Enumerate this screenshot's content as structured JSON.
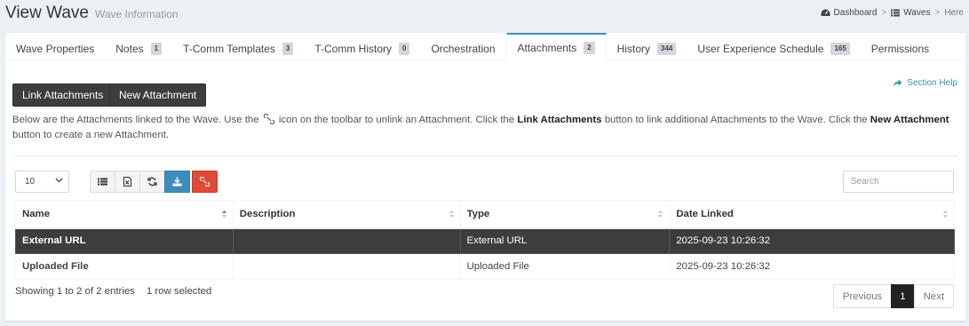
{
  "header": {
    "title": "View Wave",
    "subtitle": "Wave Information"
  },
  "breadcrumb": {
    "dashboard": "Dashboard",
    "waves": "Waves",
    "here": "Here",
    "separator": ">"
  },
  "tabs": [
    {
      "label": "Wave Properties",
      "badge": null
    },
    {
      "label": "Notes",
      "badge": "1"
    },
    {
      "label": "T-Comm Templates",
      "badge": "3"
    },
    {
      "label": "T-Comm History",
      "badge": "0"
    },
    {
      "label": "Orchestration",
      "badge": null
    },
    {
      "label": "Attachments",
      "badge": "2"
    },
    {
      "label": "History",
      "badge": "344"
    },
    {
      "label": "User Experience Schedule",
      "badge": "165"
    },
    {
      "label": "Permissions",
      "badge": null
    }
  ],
  "active_tab": "Attachments",
  "actions": {
    "link_label": "Link Attachments",
    "new_label": "New Attachment",
    "section_help": "Section Help"
  },
  "description": {
    "p1": "Below are the Attachments linked to the Wave. Use the",
    "p2": "icon on the toolbar to unlink an Attachment. Click the",
    "b1": "Link Attachments",
    "p3": "button to link additional Attachments to the Wave. Click the",
    "b2": "New Attachment",
    "p4": "button to create a new Attachment."
  },
  "table_controls": {
    "page_length": "10",
    "search_placeholder": "Search",
    "toolbar_icons": [
      "list-icon",
      "excel-icon",
      "refresh-icon",
      "download-icon",
      "unlink-icon"
    ]
  },
  "table": {
    "columns": [
      "Name",
      "Description",
      "Type",
      "Date Linked"
    ],
    "rows": [
      {
        "name": "External URL",
        "description": "",
        "type": "External URL",
        "date_linked": "2025-09-23 10:26:32",
        "selected": true
      },
      {
        "name": "Uploaded File",
        "description": "",
        "type": "Uploaded File",
        "date_linked": "2025-09-23 10:26:32",
        "selected": false
      }
    ]
  },
  "footer": {
    "info": "Showing 1 to 2 of 2 entries",
    "selection": "1 row selected"
  },
  "pagination": {
    "previous": "Previous",
    "current": "1",
    "next": "Next"
  },
  "colors": {
    "accent": "#3c8dbc",
    "dark_button": "#3d3d3d",
    "danger": "#dd4b39",
    "background": "#ecf0f5"
  }
}
